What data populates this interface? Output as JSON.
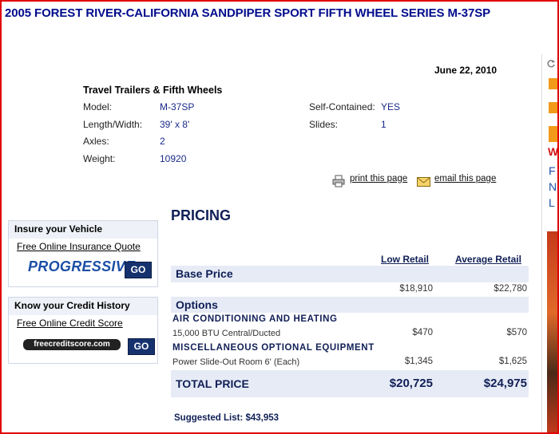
{
  "title": "2005 FOREST RIVER-CALIFORNIA SANDPIPER SPORT FIFTH WHEEL SERIES M-37SP",
  "date": "June 22, 2010",
  "category": "Travel Trailers & Fifth Wheels",
  "specs": {
    "model_label": "Model:",
    "model_value": "M-37SP",
    "length_label": "Length/Width:",
    "length_value": "39' x 8'",
    "axles_label": "Axles:",
    "axles_value": "2",
    "weight_label": "Weight:",
    "weight_value": "10920",
    "self_label": "Self-Contained:",
    "self_value": "YES",
    "slides_label": "Slides:",
    "slides_value": "1"
  },
  "actions": {
    "print": "print this page",
    "email": "email this page"
  },
  "insurance_box": {
    "heading": "Insure your Vehicle",
    "link": "Free Online Insurance Quote",
    "logo": "PROGRESSIVE",
    "go": "GO"
  },
  "credit_box": {
    "heading": "Know your Credit History",
    "link": "Free Online Credit Score",
    "logo": "freecreditscore.com",
    "go": "GO"
  },
  "pricing": {
    "heading": "PRICING",
    "col_low": "Low Retail",
    "col_avg": "Average Retail",
    "base_label": "Base Price",
    "base_low": "$18,910",
    "base_avg": "$22,780",
    "options_label": "Options",
    "sections": [
      {
        "name": "AIR CONDITIONING AND HEATING",
        "item": "15,000 BTU Central/Ducted",
        "low": "$470",
        "avg": "$570"
      },
      {
        "name": "MISCELLANEOUS OPTIONAL EQUIPMENT",
        "item": "Power Slide-Out Room 6' (Each)",
        "low": "$1,345",
        "avg": "$1,625"
      }
    ],
    "total_label": "TOTAL PRICE",
    "total_low": "$20,725",
    "total_avg": "$24,975",
    "suggested": "Suggested List: $43,953"
  },
  "ad": {
    "letters": [
      "W",
      "F",
      "N",
      "L"
    ]
  }
}
